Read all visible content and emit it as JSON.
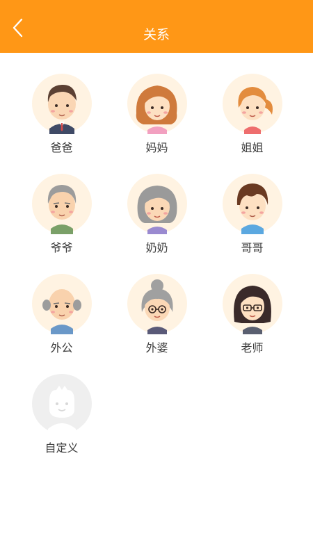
{
  "header": {
    "title": "关系",
    "back_icon": "chevron-left-icon",
    "background_color": "#ff9716"
  },
  "relations": [
    {
      "label": "爸爸",
      "icon": "father-avatar-icon"
    },
    {
      "label": "妈妈",
      "icon": "mother-avatar-icon"
    },
    {
      "label": "姐姐",
      "icon": "older-sister-avatar-icon"
    },
    {
      "label": "爷爷",
      "icon": "paternal-grandfather-avatar-icon"
    },
    {
      "label": "奶奶",
      "icon": "paternal-grandmother-avatar-icon"
    },
    {
      "label": "哥哥",
      "icon": "older-brother-avatar-icon"
    },
    {
      "label": "外公",
      "icon": "maternal-grandfather-avatar-icon"
    },
    {
      "label": "外婆",
      "icon": "maternal-grandmother-avatar-icon"
    },
    {
      "label": "老师",
      "icon": "teacher-avatar-icon"
    },
    {
      "label": "自定义",
      "icon": "custom-avatar-placeholder-icon"
    }
  ]
}
